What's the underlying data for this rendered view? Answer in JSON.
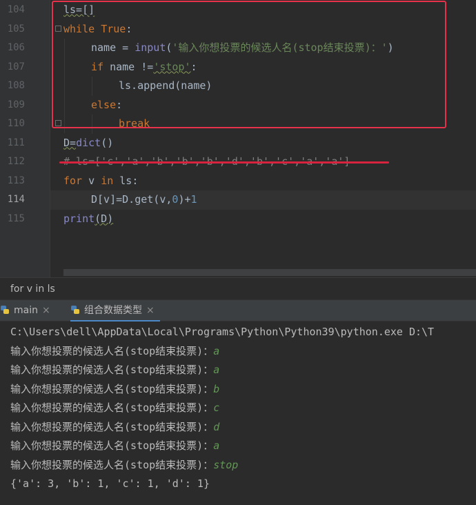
{
  "editor": {
    "line_numbers": [
      "104",
      "105",
      "106",
      "107",
      "108",
      "109",
      "110",
      "111",
      "112",
      "113",
      "114",
      "115"
    ],
    "code": {
      "l104": "ls=[]",
      "l105_kw": "while",
      "l105_val": "True",
      "l105_colon": ":",
      "l106_a": "name = ",
      "l106_fn": "input",
      "l106_paren": "(",
      "l106_str": "'输入你想投票的候选人名(stop结束投票)：'",
      "l106_close": ")",
      "l107_kw": "if",
      "l107_a": " name !=",
      "l107_str": "'stop'",
      "l107_colon": ":",
      "l108": "ls.append(name)",
      "l109_kw": "else",
      "l109_colon": ":",
      "l110_kw": "break",
      "l111_a": "D=",
      "l111_fn": "dict",
      "l111_b": "()",
      "l112": "# ls=['c','a','b','b','b','d','b','c','a','a']",
      "l113_kw1": "for",
      "l113_a": " v ",
      "l113_kw2": "in",
      "l113_b": " ls:",
      "l114_a": "D[v]=D.get(v,",
      "l114_num": "0",
      "l114_b": ")+",
      "l114_num2": "1",
      "l115_fn": "print",
      "l115_a": "(D)"
    }
  },
  "breadcrumb": "for v in ls",
  "tabs": [
    {
      "label": "main",
      "close": "×"
    },
    {
      "label": "组合数据类型",
      "close": "×"
    }
  ],
  "console": {
    "command": "C:\\Users\\dell\\AppData\\Local\\Programs\\Python\\Python39\\python.exe D:\\T",
    "prompt": "输入你想投票的候选人名(stop结束投票)：",
    "inputs": [
      "a",
      "a",
      "b",
      "c",
      "d",
      "a",
      "stop"
    ],
    "result": "{'a': 3, 'b': 1, 'c': 1, 'd': 1}"
  },
  "colors": {
    "highlight_box": "#e8314a",
    "strike_line": "#d8233f",
    "keyword": "#cc7832",
    "string": "#6a8759",
    "input_text": "#629755"
  }
}
